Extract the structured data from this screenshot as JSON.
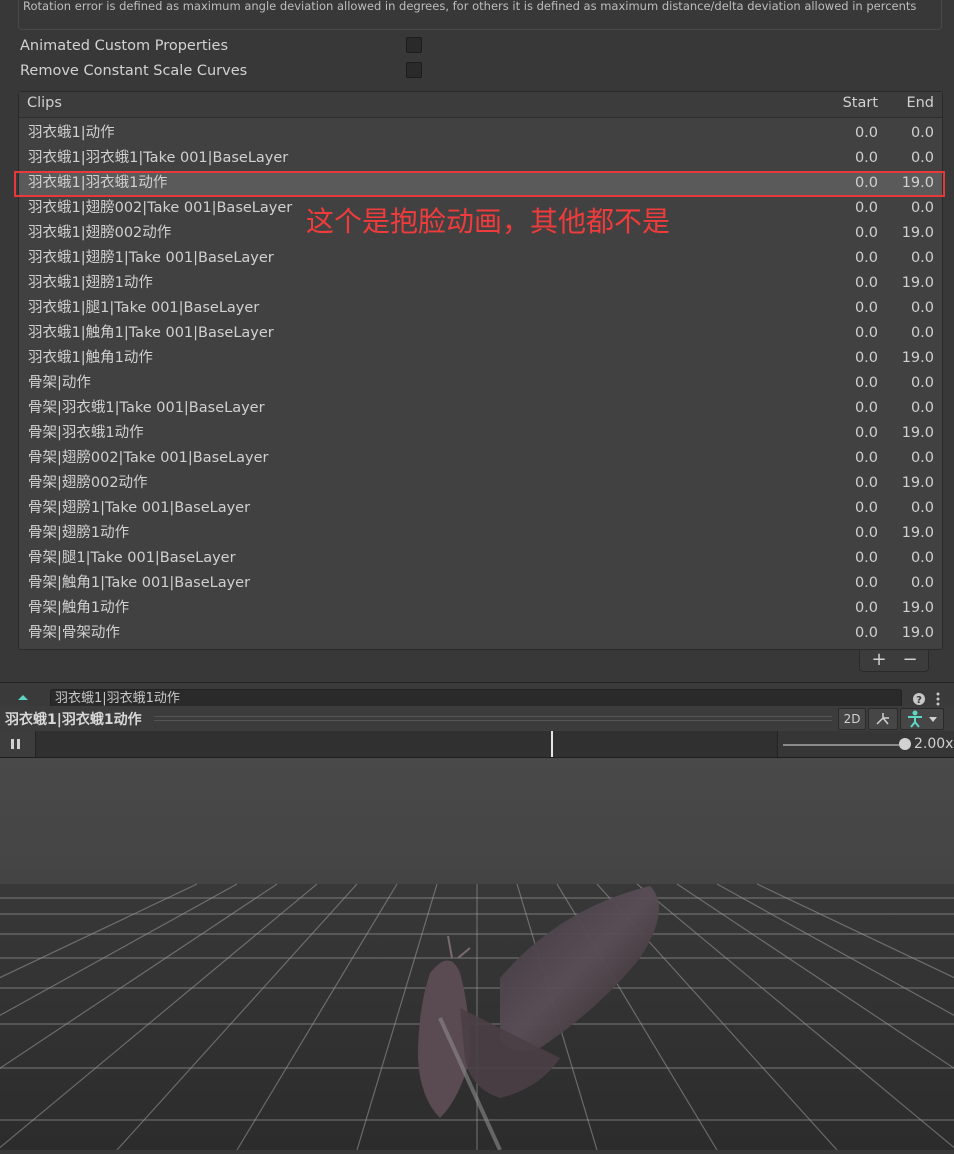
{
  "help": {
    "text": "Rotation error is defined as maximum angle deviation allowed in degrees, for others it is defined as maximum distance/delta deviation allowed in percents"
  },
  "properties": [
    {
      "label": "Animated Custom Properties",
      "checked": false
    },
    {
      "label": "Remove Constant Scale Curves",
      "checked": false
    }
  ],
  "clips": {
    "header": {
      "name": "Clips",
      "start": "Start",
      "end": "End"
    },
    "rows": [
      {
        "name": "羽衣蛾1|动作",
        "start": "0.0",
        "end": "0.0"
      },
      {
        "name": "羽衣蛾1|羽衣蛾1|Take 001|BaseLayer",
        "start": "0.0",
        "end": "0.0"
      },
      {
        "name": "羽衣蛾1|羽衣蛾1动作",
        "start": "0.0",
        "end": "19.0",
        "selected": true
      },
      {
        "name": "羽衣蛾1|翅膀002|Take 001|BaseLayer",
        "start": "0.0",
        "end": "0.0"
      },
      {
        "name": "羽衣蛾1|翅膀002动作",
        "start": "0.0",
        "end": "19.0"
      },
      {
        "name": "羽衣蛾1|翅膀1|Take 001|BaseLayer",
        "start": "0.0",
        "end": "0.0"
      },
      {
        "name": "羽衣蛾1|翅膀1动作",
        "start": "0.0",
        "end": "19.0"
      },
      {
        "name": "羽衣蛾1|腿1|Take 001|BaseLayer",
        "start": "0.0",
        "end": "0.0"
      },
      {
        "name": "羽衣蛾1|触角1|Take 001|BaseLayer",
        "start": "0.0",
        "end": "0.0"
      },
      {
        "name": "羽衣蛾1|触角1动作",
        "start": "0.0",
        "end": "19.0"
      },
      {
        "name": "骨架|动作",
        "start": "0.0",
        "end": "0.0"
      },
      {
        "name": "骨架|羽衣蛾1|Take 001|BaseLayer",
        "start": "0.0",
        "end": "0.0"
      },
      {
        "name": "骨架|羽衣蛾1动作",
        "start": "0.0",
        "end": "19.0"
      },
      {
        "name": "骨架|翅膀002|Take 001|BaseLayer",
        "start": "0.0",
        "end": "0.0"
      },
      {
        "name": "骨架|翅膀002动作",
        "start": "0.0",
        "end": "19.0"
      },
      {
        "name": "骨架|翅膀1|Take 001|BaseLayer",
        "start": "0.0",
        "end": "0.0"
      },
      {
        "name": "骨架|翅膀1动作",
        "start": "0.0",
        "end": "19.0"
      },
      {
        "name": "骨架|腿1|Take 001|BaseLayer",
        "start": "0.0",
        "end": "0.0"
      },
      {
        "name": "骨架|触角1|Take 001|BaseLayer",
        "start": "0.0",
        "end": "0.0"
      },
      {
        "name": "骨架|触角1动作",
        "start": "0.0",
        "end": "19.0"
      },
      {
        "name": "骨架|骨架动作",
        "start": "0.0",
        "end": "19.0"
      }
    ],
    "add_label": "+",
    "remove_label": "−"
  },
  "annotation": {
    "text": "这个是抱脸动画，其他都不是",
    "color": "#ef3b3b"
  },
  "preview": {
    "clip_field": "羽衣蛾1|羽衣蛾1动作",
    "title": "羽衣蛾1|羽衣蛾1动作",
    "mode_2d_label": "2D",
    "speed_label": "2.00x",
    "speed_value": 2.0,
    "timeline_position": 0.697
  },
  "colors": {
    "accent": "#e8393a",
    "panel": "#414141",
    "selected_row": "#5a5a5a",
    "avatar_icon": "#5fd6c4"
  }
}
